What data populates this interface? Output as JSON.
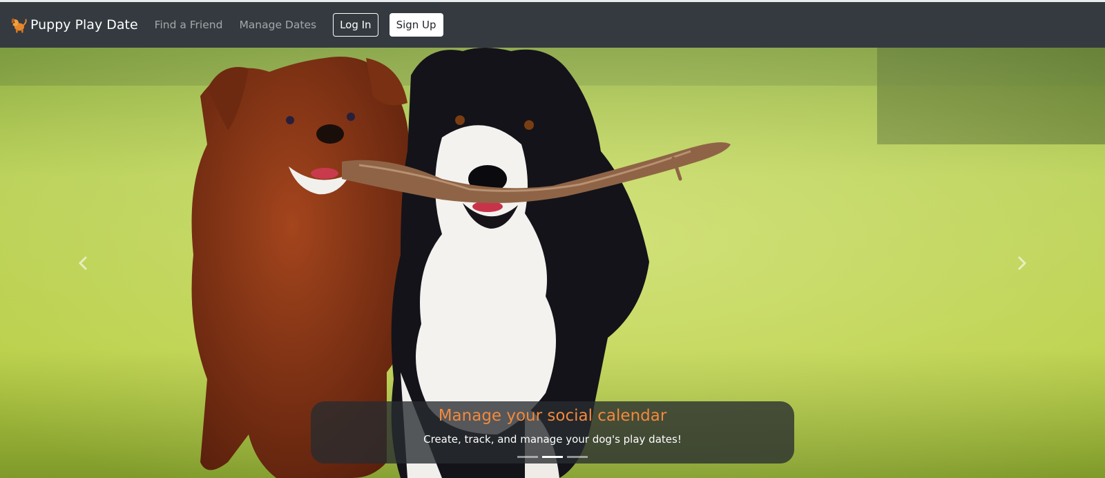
{
  "navbar": {
    "brand_name": "Puppy Play Date",
    "brand_icon": "dog-icon",
    "links": [
      "Find a Friend",
      "Manage Dates"
    ],
    "login_label": "Log In",
    "signup_label": "Sign Up"
  },
  "carousel": {
    "caption_title": "Manage your social calendar",
    "caption_text": "Create, track, and manage your dog's play dates!",
    "slide_count": 3,
    "active_index": 1,
    "prev_icon": "chevron-left-icon",
    "next_icon": "chevron-right-icon"
  },
  "colors": {
    "navbar_bg": "#343a40",
    "accent": "#f2893d"
  }
}
